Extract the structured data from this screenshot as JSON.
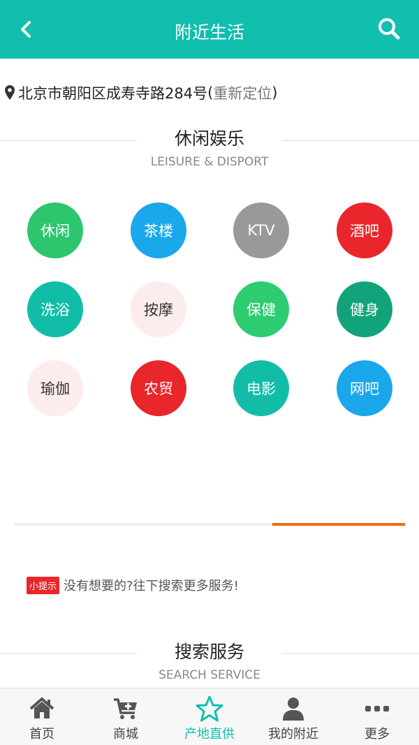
{
  "header": {
    "title": "附近生活",
    "back_icon": "chevron-left-icon",
    "search_icon": "search-icon"
  },
  "location": {
    "address": "北京市朝阳区成寿寺路284号",
    "open_paren": " (",
    "relocate_label": "重新定位",
    "close_paren": ")",
    "icon": "map-pin-icon"
  },
  "leisure": {
    "title": "休闲娱乐",
    "subtitle": "LEISURE & DISPORT"
  },
  "categories": [
    {
      "label": "休闲",
      "color": "#2dc66f"
    },
    {
      "label": "茶楼",
      "color": "#1aa7ec"
    },
    {
      "label": "KTV",
      "color": "#999999"
    },
    {
      "label": "酒吧",
      "color": "#e8262c"
    },
    {
      "label": "洗浴",
      "color": "#12bda8"
    },
    {
      "label": "按摩",
      "color": "#fdecec"
    },
    {
      "label": "保健",
      "color": "#2ecc71"
    },
    {
      "label": "健身",
      "color": "#12a37a"
    },
    {
      "label": "瑜伽",
      "color": "#fdecec"
    },
    {
      "label": "农贸",
      "color": "#e8262c"
    },
    {
      "label": "电影",
      "color": "#12bda8"
    },
    {
      "label": "网吧",
      "color": "#1aa7ec"
    }
  ],
  "carousel_progress": 0.34,
  "tip": {
    "badge": "小提示",
    "text": "没有想要的?往下搜索更多服务!"
  },
  "search_service": {
    "title": "搜索服务",
    "subtitle": "SEARCH SERVICE"
  },
  "tabbar": {
    "active_color": "#10bfae",
    "items": [
      {
        "label": "首页",
        "icon": "home-icon"
      },
      {
        "label": "商城",
        "icon": "cart-icon"
      },
      {
        "label": "产地直供",
        "icon": "star-icon"
      },
      {
        "label": "我的附近",
        "icon": "user-icon"
      },
      {
        "label": "更多",
        "icon": "more-icon"
      }
    ]
  }
}
